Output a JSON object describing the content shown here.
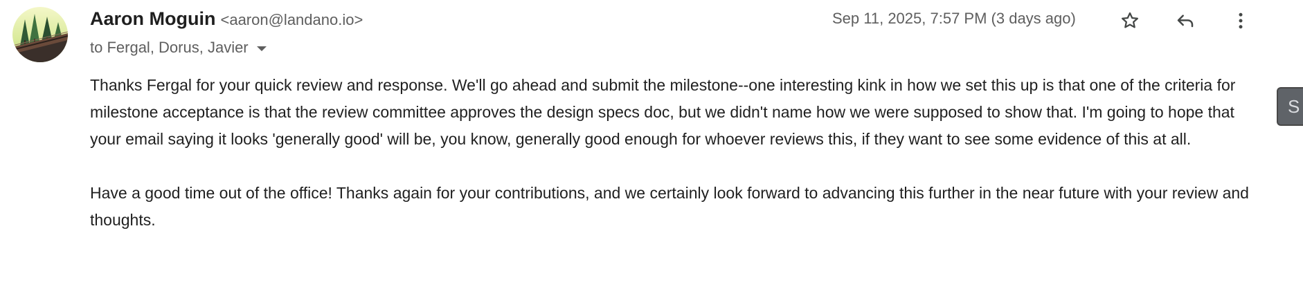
{
  "sender": {
    "name": "Aaron Moguin",
    "email": "<aaron@landano.io>",
    "avatar_icon": "forest-avatar"
  },
  "recipients": {
    "label": "to Fergal, Dorus, Javier",
    "expand_icon": "caret-down-icon"
  },
  "timestamp": "Sep 11, 2025, 7:57 PM (3 days ago)",
  "actions": {
    "star_icon": "star-outline-icon",
    "reply_icon": "reply-icon",
    "more_icon": "more-vertical-icon"
  },
  "body": {
    "paragraphs": [
      "Thanks Fergal for your quick review and response. We'll go ahead and submit the milestone--one interesting kink in how we set this up is that one of the criteria for milestone acceptance is that the review committee approves the design specs doc, but we didn't name how we were supposed to show that. I'm going to hope that your email saying it looks 'generally good' will be, you know, generally good enough for whoever reviews this, if they want to see some evidence of this at all.",
      "Have a good time out of the office! Thanks again for your contributions, and we certainly look forward to advancing this further in the near future with your review and thoughts."
    ]
  },
  "side_tab": {
    "label": "S"
  },
  "colors": {
    "text_primary": "#1f1f1f",
    "text_secondary": "#5e5e5e",
    "icon": "#444746"
  }
}
